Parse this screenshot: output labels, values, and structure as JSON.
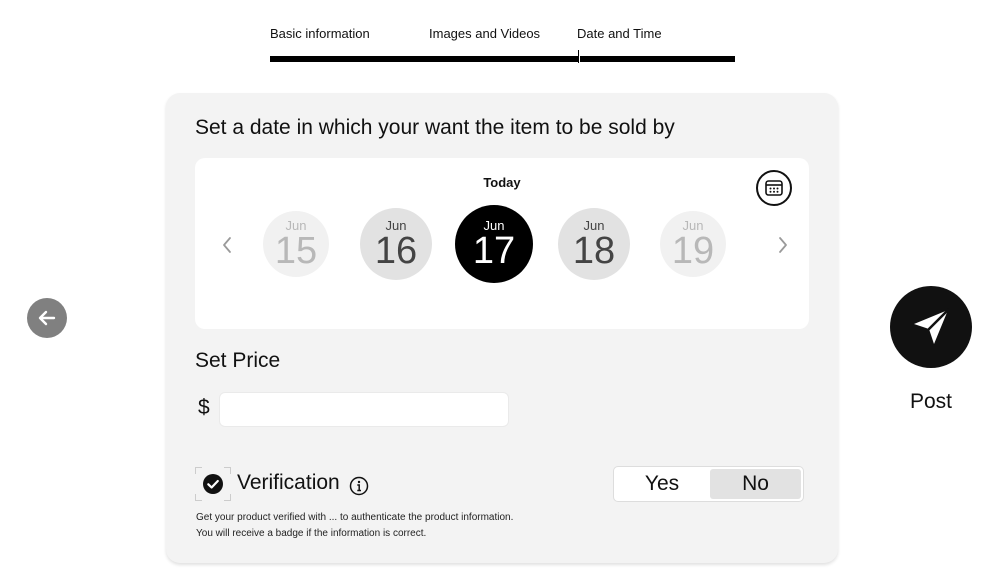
{
  "tabs": [
    "Basic information",
    "Images and Videos",
    "Date and Time"
  ],
  "date_section": {
    "title": "Set a date in which your want the item to be sold by",
    "today_label": "Today",
    "days": [
      {
        "month": "Jun",
        "day": "15"
      },
      {
        "month": "Jun",
        "day": "16"
      },
      {
        "month": "Jun",
        "day": "17"
      },
      {
        "month": "Jun",
        "day": "18"
      },
      {
        "month": "Jun",
        "day": "19"
      }
    ],
    "selected_index": 2,
    "icons": {
      "prev": "chevron-left-icon",
      "next": "chevron-right-icon",
      "calendar": "calendar-icon"
    }
  },
  "price_section": {
    "title": "Set Price",
    "currency": "$",
    "value": "",
    "placeholder": ""
  },
  "verification": {
    "label": "Verification",
    "options": [
      "Yes",
      "No"
    ],
    "selected": "No",
    "help_lines": [
      "Get your product verified with ... to authenticate the product information.",
      "You will receive a badge if the information is correct."
    ],
    "icons": {
      "check": "check-circle-icon",
      "info": "info-icon"
    }
  },
  "post": {
    "label": "Post",
    "icon": "send-icon"
  },
  "back": {
    "icon": "arrow-left-icon"
  },
  "colors": {
    "accent": "#000000",
    "card": "#f3f3f3",
    "back_button": "#808080"
  }
}
